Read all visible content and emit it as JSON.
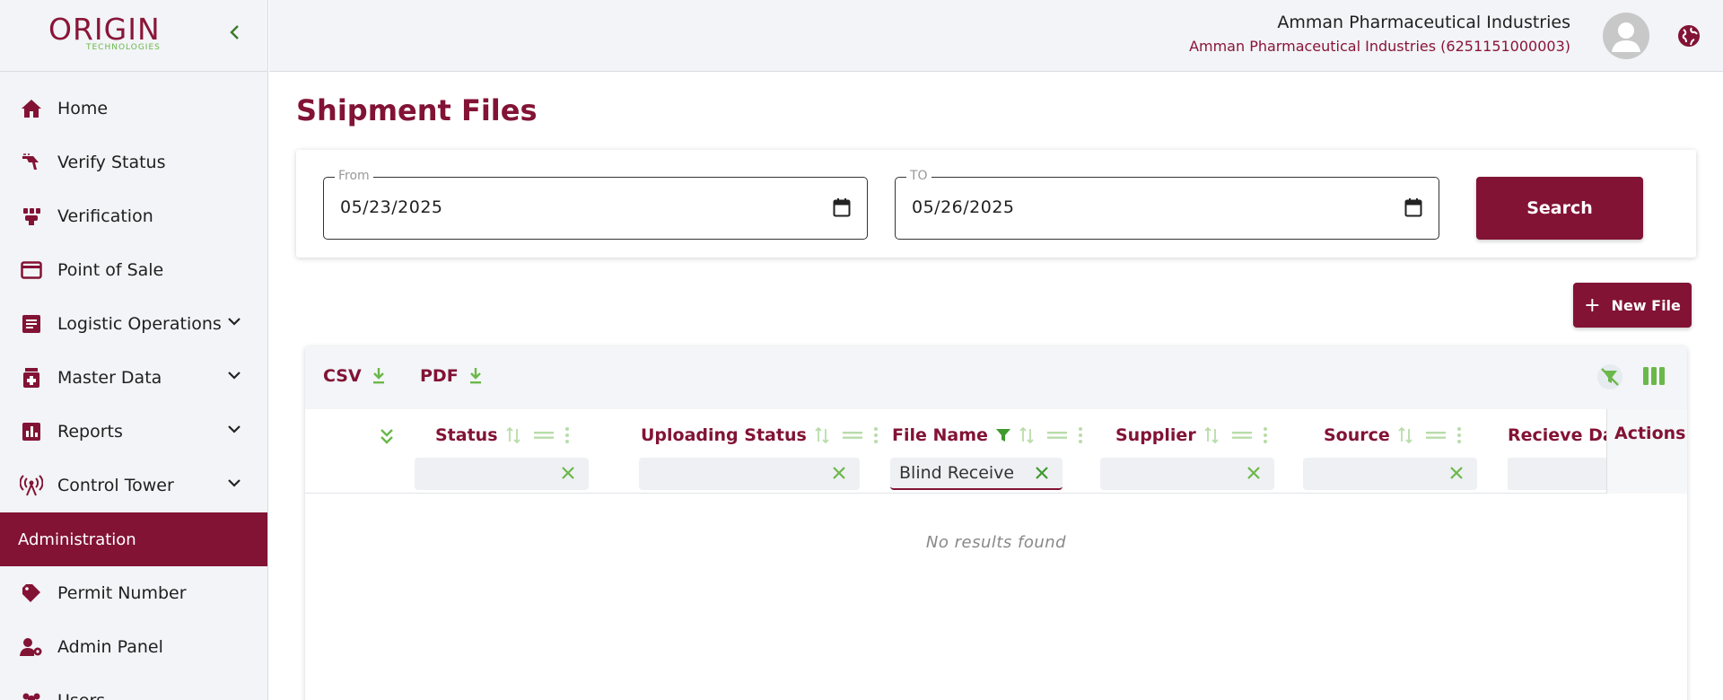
{
  "brand": {
    "logo_text": "ORIGIN",
    "logo_sub": "TECHNOLOGIES",
    "primary_color": "#821335",
    "accent_color": "#6bb84a"
  },
  "sidebar": {
    "collapse_icon": "chevron-left-icon",
    "items": [
      {
        "label": "Home",
        "icon": "home-icon"
      },
      {
        "label": "Verify Status",
        "icon": "scanner-icon"
      },
      {
        "label": "Verification",
        "icon": "verification-icon"
      },
      {
        "label": "Point of Sale",
        "icon": "credit-card-icon"
      },
      {
        "label": "Logistic Operations",
        "icon": "document-icon",
        "expandable": true
      },
      {
        "label": "Master Data",
        "icon": "medical-box-icon",
        "expandable": true
      },
      {
        "label": "Reports",
        "icon": "bar-chart-icon",
        "expandable": true
      },
      {
        "label": "Control Tower",
        "icon": "antenna-icon",
        "expandable": true
      },
      {
        "label": "Administration",
        "active": true
      },
      {
        "label": "Permit Number",
        "icon": "tag-icon"
      },
      {
        "label": "Admin Panel",
        "icon": "user-gear-icon"
      },
      {
        "label": "Users",
        "icon": "users-icon"
      }
    ]
  },
  "header": {
    "company_name": "Amman Pharmaceutical Industries",
    "company_detail": "Amman Pharmaceutical Industries (6251151000003)"
  },
  "page": {
    "title": "Shipment Files"
  },
  "filters": {
    "from_label": "From",
    "from_value": "05/23/2025",
    "to_label": "TO",
    "to_value": "05/26/2025",
    "search_label": "Search"
  },
  "actions": {
    "new_file_label": "New File"
  },
  "table": {
    "export_csv": "CSV",
    "export_pdf": "PDF",
    "columns": [
      {
        "title": "Status",
        "filter_value": ""
      },
      {
        "title": "Uploading Status",
        "filter_value": ""
      },
      {
        "title": "File Name",
        "filter_value": "Blind Receive",
        "filtered": true
      },
      {
        "title": "Supplier",
        "filter_value": ""
      },
      {
        "title": "Source",
        "filter_value": ""
      },
      {
        "title": "Recieve Dat",
        "filter_value": ""
      }
    ],
    "actions_title": "Actions",
    "empty_message": "No results found"
  }
}
